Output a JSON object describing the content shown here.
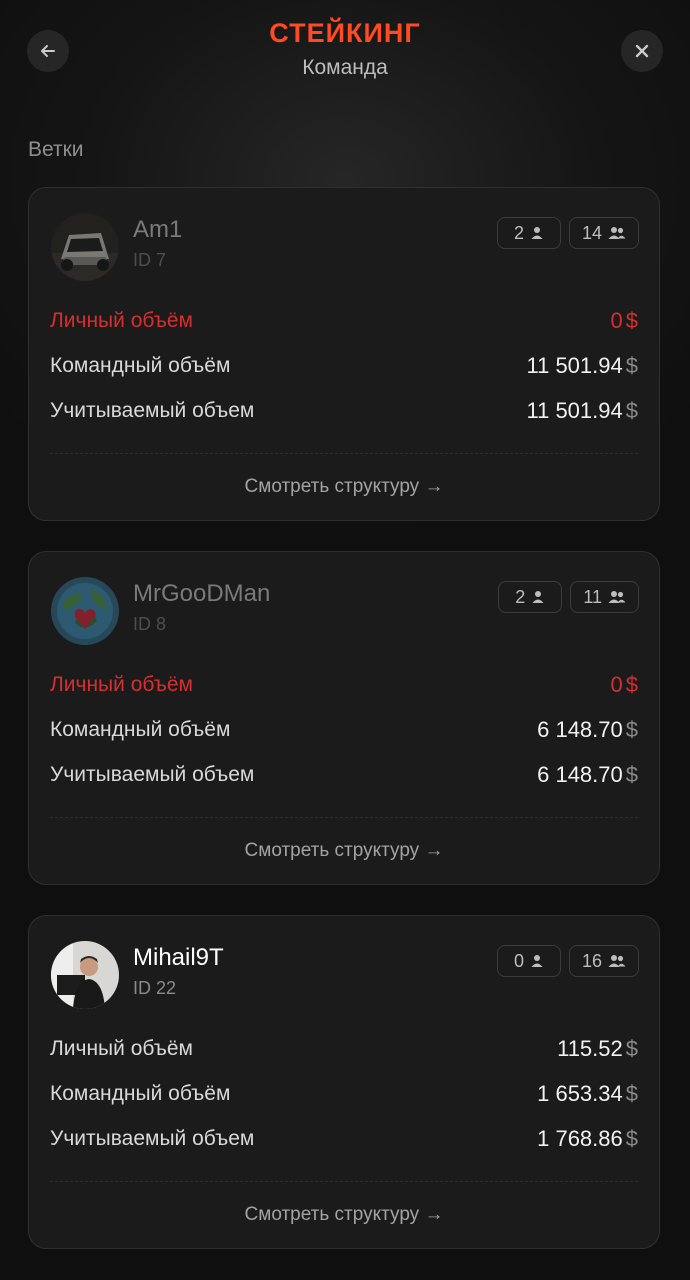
{
  "header": {
    "title": "СТЕЙКИНГ",
    "subtitle": "Команда",
    "back_icon": "arrow-left-icon",
    "close_icon": "close-icon"
  },
  "section_label": "Ветки",
  "colors": {
    "accent": "#ff4a22",
    "negative": "#d62f2f",
    "card_bg": "#1b1b1b"
  },
  "labels": {
    "personal_volume": "Личный объём",
    "team_volume": "Командный объём",
    "counted_volume": "Учитываемый объем",
    "view_structure": "Смотреть структуру →",
    "currency": "$"
  },
  "branches": [
    {
      "name": "Am1",
      "id": "ID 7",
      "direct_count": "2",
      "team_count": "14",
      "personal_volume": "0",
      "team_volume": "11 501.94",
      "counted_volume": "11 501.94",
      "active": false,
      "avatar": "car-photo"
    },
    {
      "name": "MrGooDMan",
      "id": "ID 8",
      "direct_count": "2",
      "team_count": "11",
      "personal_volume": "0",
      "team_volume": "6 148.70",
      "counted_volume": "6 148.70",
      "active": false,
      "avatar": "earth-heart-illustration"
    },
    {
      "name": "Mihail9T",
      "id": "ID 22",
      "direct_count": "0",
      "team_count": "16",
      "personal_volume": "115.52",
      "team_volume": "1 653.34",
      "counted_volume": "1 768.86",
      "active": true,
      "avatar": "person-photo"
    }
  ]
}
